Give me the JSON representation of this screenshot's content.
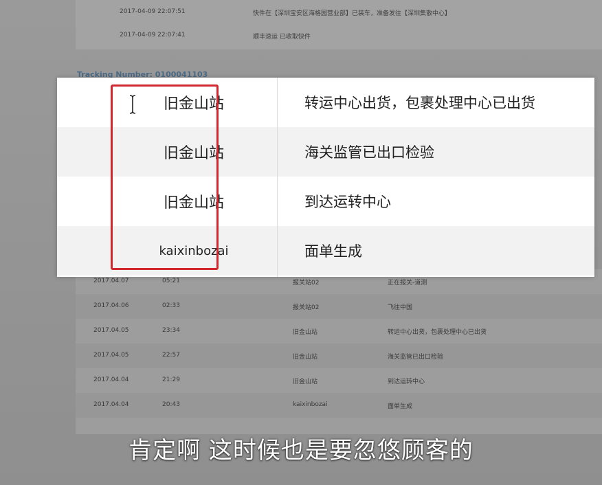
{
  "background_page": {
    "top_rows": [
      {
        "time": "2017-04-09 22:07:51",
        "desc": "快件在【深圳宝安区海格园营业部】已装车，准备发往【深圳集散中心】"
      },
      {
        "time": "2017-04-09 22:07:41",
        "desc": "顺丰速运 已收取快件"
      }
    ],
    "tracking_label": "Tracking Number: 0100041103",
    "rows": [
      {
        "date": "2017.04.07",
        "time": "05:21",
        "location": "报关站02",
        "status": "正在报关-道测"
      },
      {
        "date": "2017.04.06",
        "time": "02:33",
        "location": "报关站02",
        "status": "飞往中国"
      },
      {
        "date": "2017.04.05",
        "time": "23:34",
        "location": "旧金山站",
        "status": "转运中心出货，包裹处理中心已出货"
      },
      {
        "date": "2017.04.05",
        "time": "22:57",
        "location": "旧金山站",
        "status": "海关监管已出口检验"
      },
      {
        "date": "2017.04.04",
        "time": "21:29",
        "location": "旧金山站",
        "status": "到达运转中心"
      },
      {
        "date": "2017.04.04",
        "time": "20:43",
        "location": "kaixinbozai",
        "status": "面单生成"
      }
    ]
  },
  "highlight_card": {
    "rows": [
      {
        "station": "旧金山站",
        "event": "转运中心出货，包裹处理中心已出货"
      },
      {
        "station": "旧金山站",
        "event": "海关监管已出口检验"
      },
      {
        "station": "旧金山站",
        "event": "到达运转中心"
      },
      {
        "station": "kaixinbozai",
        "event": "面单生成"
      }
    ]
  },
  "subtitle": "肯定啊 这时候也是要忽悠顾客的",
  "colors": {
    "highlight_border": "#d0282e",
    "card_bg": "#ffffff",
    "dim_bg": "#8c8c8c"
  }
}
